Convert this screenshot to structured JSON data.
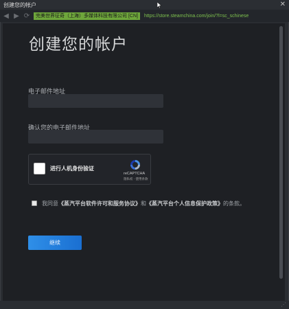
{
  "window": {
    "title": "创建您的帐户",
    "close_glyph": "✕",
    "resize_glyph": "⋰"
  },
  "navbar": {
    "back_glyph": "◀",
    "forward_glyph": "▶",
    "reload_glyph": "⟳",
    "certificate": "完美世界征奇（上海）多媒体科技有限公司 [CN]",
    "url": "https://store.steamchina.com/join/?l=sc_schinese"
  },
  "form": {
    "heading": "创建您的帐户",
    "email_label": "电子邮件地址",
    "email_value": "",
    "confirm_label": "确认您的电子邮件地址",
    "confirm_value": "",
    "captcha": {
      "label": "进行人机身份验证",
      "brand": "reCAPTCHA",
      "links": "隐私权 - 使用条款"
    },
    "agreement": {
      "prefix": "我同意",
      "agreement1": "《蒸汽平台软件许可和服务协议》",
      "and": "和",
      "agreement2": "《蒸汽平台个人信息保护政策》",
      "suffix": "的条款。"
    },
    "continue_label": "继续"
  },
  "colors": {
    "accent": "#1a6fd1",
    "cert_bg": "#6ea63b",
    "url_text": "#7ec24e",
    "background": "#1e2024"
  }
}
